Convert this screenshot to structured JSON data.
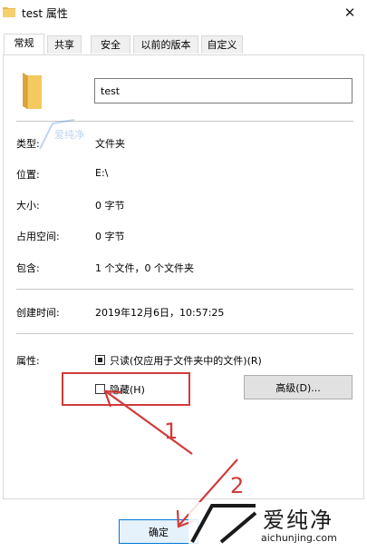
{
  "window": {
    "title": "test 属性",
    "close_glyph": "✕"
  },
  "tabs": [
    {
      "label": "常规",
      "active": true
    },
    {
      "label": "共享"
    },
    {
      "label": "安全"
    },
    {
      "label": "以前的版本"
    },
    {
      "label": "自定义"
    }
  ],
  "general": {
    "name_value": "test",
    "rows": [
      {
        "label": "类型:",
        "value": "文件夹"
      },
      {
        "label": "位置:",
        "value": "E:\\"
      },
      {
        "label": "大小:",
        "value": "0 字节"
      },
      {
        "label": "占用空间:",
        "value": "0 字节"
      },
      {
        "label": "包含:",
        "value": "1 个文件，0 个文件夹"
      },
      {
        "label": "创建时间:",
        "value": "2019年12月6日，10:57:25"
      }
    ],
    "attributes_label": "属性:",
    "readonly_label": "只读(仅应用于文件夹中的文件)(R)",
    "hidden_label": "隐藏(H)",
    "advanced_button": "高级(D)..."
  },
  "footer": {
    "ok_button": "确定"
  },
  "annotations": {
    "step1": "1",
    "step2": "2",
    "color": "#d23a3a"
  },
  "watermark": {
    "text": "爱纯净",
    "url": "aichunjing.com",
    "badge": "爱纯净"
  },
  "icons": {
    "folder": "folder-icon"
  }
}
